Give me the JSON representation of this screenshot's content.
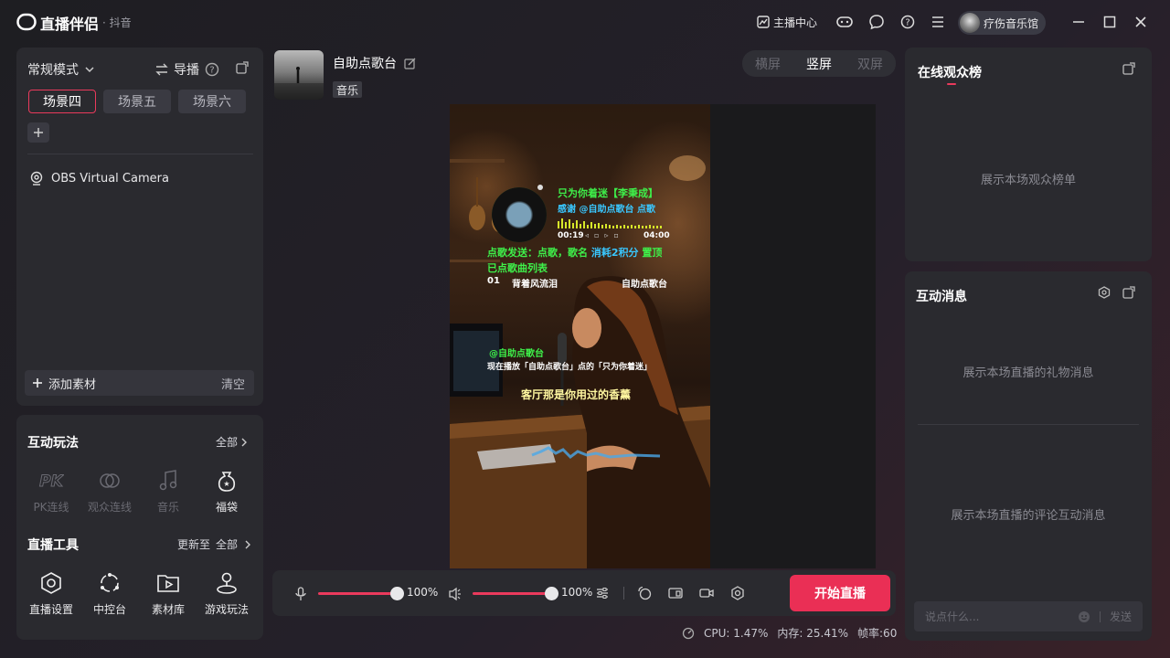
{
  "titlebar": {
    "app_title": "直播伴侣",
    "app_subtitle": "· 抖音",
    "host_center": "主播中心",
    "username": "疗伤音乐馆"
  },
  "scene_panel": {
    "mode": "常规模式",
    "director": "导播",
    "tabs": [
      "场景四",
      "场景五",
      "场景六"
    ],
    "active_tab": 0,
    "sources": [
      "OBS Virtual Camera"
    ],
    "add_material": "添加素材",
    "clear": "清空"
  },
  "interactive": {
    "title": "互动玩法",
    "all": "全部",
    "items": [
      {
        "label": "PK连线",
        "icon": "pk-icon",
        "enabled": false
      },
      {
        "label": "观众连线",
        "icon": "audience-link-icon",
        "enabled": false
      },
      {
        "label": "音乐",
        "icon": "music-icon",
        "enabled": false
      },
      {
        "label": "福袋",
        "icon": "lucky-bag-icon",
        "enabled": true
      }
    ]
  },
  "live_tools": {
    "title": "直播工具",
    "updated": "更新至",
    "all": "全部",
    "items": [
      {
        "label": "直播设置",
        "icon": "settings-hex-icon"
      },
      {
        "label": "中控台",
        "icon": "control-center-icon"
      },
      {
        "label": "素材库",
        "icon": "library-icon"
      },
      {
        "label": "游戏玩法",
        "icon": "game-icon"
      }
    ]
  },
  "stream": {
    "title": "自助点歌台",
    "tag": "音乐",
    "orientations": [
      "横屏",
      "竖屏",
      "双屏"
    ],
    "active_orientation": 1
  },
  "preview": {
    "song_now": "只为你着迷【李秉成】",
    "thanks": "感谢 @自助点歌台 点歌",
    "time_elapsed": "00:19",
    "time_total": "04:00",
    "request_hint_a": "点歌发送：点歌，歌名",
    "request_hint_b": "消耗2积分",
    "request_hint_c": "置顶",
    "queue_title": "已点歌曲列表",
    "queue_index": "01",
    "queue_song": "背着风流泪",
    "queue_user": "自助点歌台",
    "mention": "@自助点歌台",
    "now_playing_line": "现在播放「自助点歌台」点的「只为你着迷」",
    "lyric": "客厅那是你用过的香薰"
  },
  "controls": {
    "mic_volume": "100%",
    "mic_level": 1.0,
    "speaker_volume": "100%",
    "speaker_level": 1.0,
    "go_live": "开始直播"
  },
  "status": {
    "cpu": "CPU: 1.47%",
    "memory": "内存: 25.41%",
    "fps": "帧率:60"
  },
  "audience": {
    "title": "在线观众榜",
    "placeholder": "展示本场观众榜单"
  },
  "messages": {
    "title": "互动消息",
    "gift_placeholder": "展示本场直播的礼物消息",
    "comment_placeholder": "展示本场直播的评论互动消息",
    "input_placeholder": "说点什么...",
    "send": "发送"
  },
  "colors": {
    "accent": "#ea2f55",
    "overlay_green": "#3ef04a",
    "overlay_cyan": "#39c7ff"
  }
}
